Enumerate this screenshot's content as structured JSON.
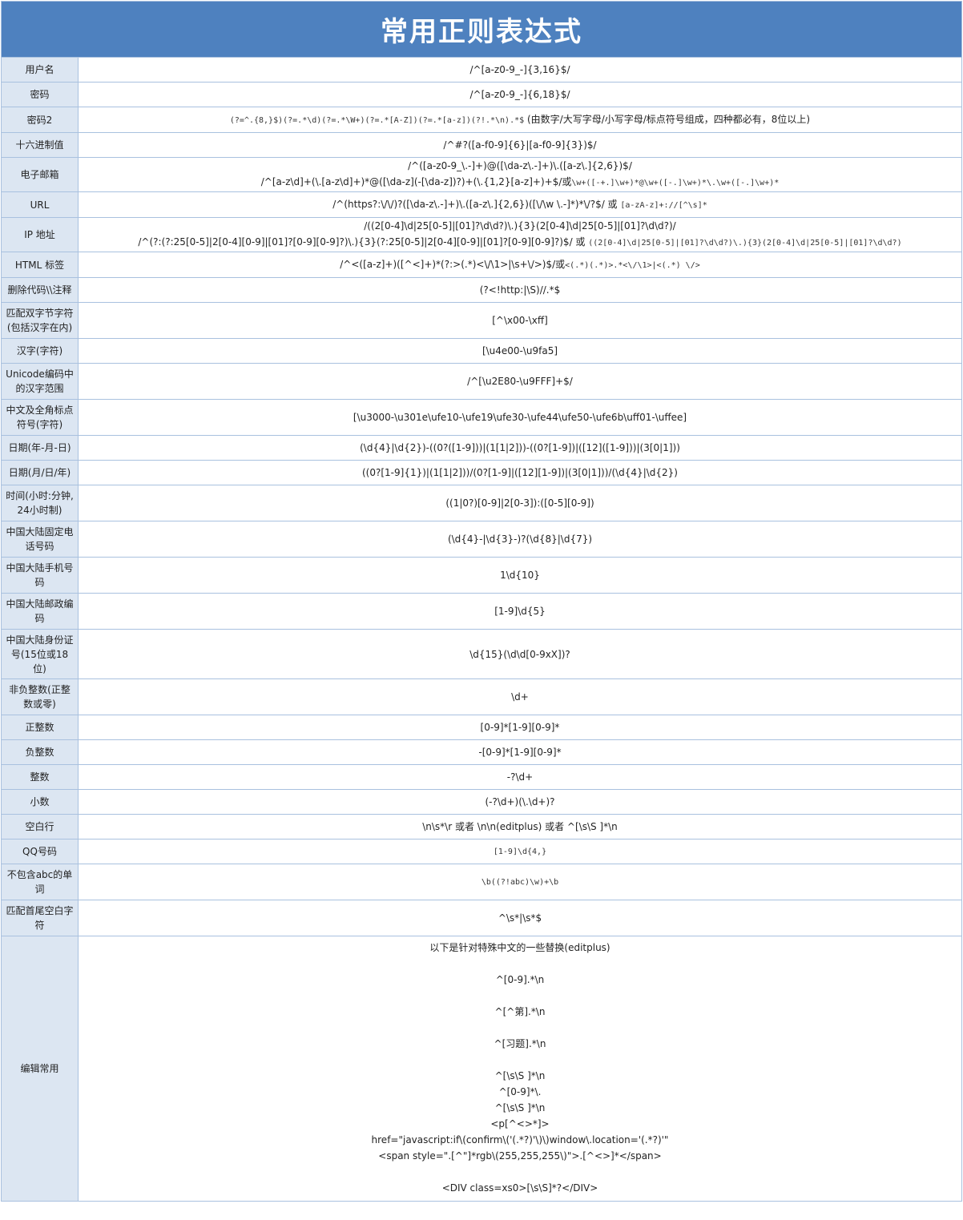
{
  "title": "常用正则表达式",
  "rows": [
    {
      "label": "用户名",
      "value": "/^[a-z0-9_-]{3,16}$/"
    },
    {
      "label": "密码",
      "value": "/^[a-z0-9_-]{6,18}$/"
    },
    {
      "label": "密码2",
      "value_mono": "(?=^.{8,}$)(?=.*\\d)(?=.*\\W+)(?=.*[A-Z])(?=.*[a-z])(?!.*\\n).*$",
      "value_note": " (由数字/大写字母/小写字母/标点符号组成，四种都必有，8位以上)"
    },
    {
      "label": "十六进制值",
      "value": "/^#?([a-f0-9]{6}|[a-f0-9]{3})$/"
    },
    {
      "label": "电子邮箱",
      "value": "/^([a-z0-9_\\.-]+)@([\\da-z\\.-]+)\\.([a-z\\.]{2,6})$/",
      "value2": "/^[a-z\\d]+(\\.[a-z\\d]+)*@([\\da-z](-[\\da-z])?)+(\\.{1,2}[a-z]+)+$/或",
      "value2_mono": "\\w+([-+.]\\w+)*@\\w+([-.]\\w+)*\\.\\w+([-.]\\w+)*"
    },
    {
      "label": "URL",
      "value": "/^(https?:\\/\\/)?([\\da-z\\.-]+)\\.([a-z\\.]{2,6})([\\/\\w \\.-]*)*\\/?$/ 或 ",
      "value_mono": "[a-zA-z]+://[^\\s]*"
    },
    {
      "label": "IP 地址",
      "value": "/((2[0-4]\\d|25[0-5]|[01]?\\d\\d?)\\.){3}(2[0-4]\\d|25[0-5]|[01]?\\d\\d?)/",
      "value2": "/^(?:(?:25[0-5]|2[0-4][0-9]|[01]?[0-9][0-9]?)\\.){3}(?:25[0-5]|2[0-4][0-9]|[01]?[0-9][0-9]?)$/ 或 ",
      "value2_mono": "((2[0-4]\\d|25[0-5]|[01]?\\d\\d?)\\.){3}(2[0-4]\\d|25[0-5]|[01]?\\d\\d?)"
    },
    {
      "label": "HTML 标签",
      "value": "/^<([a-z]+)([^<]+)*(?:>(.*)<\\/\\1>|\\s+\\/>)$/或",
      "value_mono": "<(.*)(.*)>.*<\\/\\1>|<(.*) \\/>"
    },
    {
      "label": "删除代码\\\\注释",
      "value": "(?<!http:|\\S)//.*$"
    },
    {
      "label": "匹配双字节字符(包括汉字在内)",
      "value": "[^\\x00-\\xff]"
    },
    {
      "label": "汉字(字符)",
      "value": "[\\u4e00-\\u9fa5]"
    },
    {
      "label": "Unicode编码中的汉字范围",
      "value": "/^[\\u2E80-\\u9FFF]+$/"
    },
    {
      "label": "中文及全角标点符号(字符)",
      "value": "[\\u3000-\\u301e\\ufe10-\\ufe19\\ufe30-\\ufe44\\ufe50-\\ufe6b\\uff01-\\uffee]"
    },
    {
      "label": "日期(年-月-日)",
      "value": "(\\d{4}|\\d{2})-((0?([1-9]))|(1[1|2]))-((0?[1-9])|([12]([1-9]))|(3[0|1]))"
    },
    {
      "label": "日期(月/日/年)",
      "value": "((0?[1-9]{1})|(1[1|2]))/(0?[1-9]|([12][1-9])|(3[0|1]))/(\\d{4}|\\d{2})"
    },
    {
      "label": "时间(小时:分钟, 24小时制)",
      "value": "((1|0?)[0-9]|2[0-3]):([0-5][0-9])"
    },
    {
      "label": "中国大陆固定电话号码",
      "value": "(\\d{4}-|\\d{3}-)?(\\d{8}|\\d{7})"
    },
    {
      "label": "中国大陆手机号码",
      "value": "1\\d{10}"
    },
    {
      "label": "中国大陆邮政编码",
      "value": "[1-9]\\d{5}"
    },
    {
      "label": "中国大陆身份证号(15位或18位)",
      "value": "\\d{15}(\\d\\d[0-9xX])?"
    },
    {
      "label": "非负整数(正整数或零)",
      "value": "\\d+"
    },
    {
      "label": "正整数",
      "value": "[0-9]*[1-9][0-9]*"
    },
    {
      "label": "负整数",
      "value": "-[0-9]*[1-9][0-9]*"
    },
    {
      "label": "整数",
      "value": "-?\\d+"
    },
    {
      "label": "小数",
      "value": "(-?\\d+)(\\.\\d+)?"
    },
    {
      "label": "空白行",
      "value": "\\n\\s*\\r 或者 \\n\\n(editplus) 或者 ^[\\s\\S ]*\\n"
    },
    {
      "label": "QQ号码",
      "value_mono": "[1-9]\\d{4,}"
    },
    {
      "label": "不包含abc的单词",
      "value_mono": "\\b((?!abc)\\w)+\\b"
    },
    {
      "label": "匹配首尾空白字符",
      "value": "^\\s*|\\s*$"
    }
  ],
  "edit": {
    "label": "编辑常用",
    "lines": [
      "以下是针对特殊中文的一些替换(editplus)",
      "",
      "^[0-9].*\\n",
      "",
      "^[^第].*\\n",
      "",
      "^[习题].*\\n",
      "",
      "^[\\s\\S ]*\\n",
      "^[0-9]*\\.",
      "^[\\s\\S ]*\\n",
      "<p[^<>*]>",
      "href=\"javascript:if\\(confirm\\('(.*?)'\\)\\)window\\.location='(.*?)'\"",
      "<span style=\".[^\"]*rgb\\(255,255,255\\)\">.[^<>]*</span>",
      "",
      "<DIV class=xs0>[\\s\\S]*?</DIV>"
    ]
  }
}
